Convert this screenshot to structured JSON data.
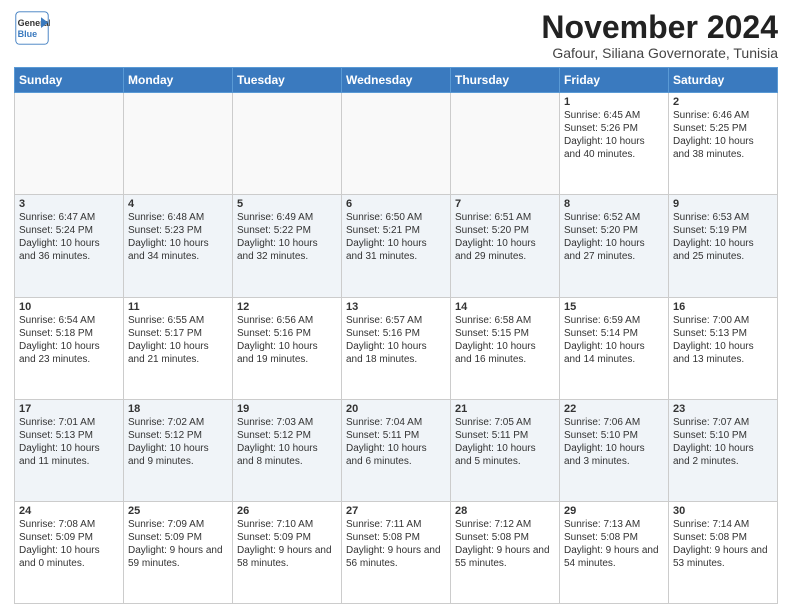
{
  "header": {
    "logo_line1": "General",
    "logo_line2": "Blue",
    "month": "November 2024",
    "location": "Gafour, Siliana Governorate, Tunisia"
  },
  "weekdays": [
    "Sunday",
    "Monday",
    "Tuesday",
    "Wednesday",
    "Thursday",
    "Friday",
    "Saturday"
  ],
  "weeks": [
    [
      {
        "day": "",
        "content": ""
      },
      {
        "day": "",
        "content": ""
      },
      {
        "day": "",
        "content": ""
      },
      {
        "day": "",
        "content": ""
      },
      {
        "day": "",
        "content": ""
      },
      {
        "day": "1",
        "content": "Sunrise: 6:45 AM\nSunset: 5:26 PM\nDaylight: 10 hours and 40 minutes."
      },
      {
        "day": "2",
        "content": "Sunrise: 6:46 AM\nSunset: 5:25 PM\nDaylight: 10 hours and 38 minutes."
      }
    ],
    [
      {
        "day": "3",
        "content": "Sunrise: 6:47 AM\nSunset: 5:24 PM\nDaylight: 10 hours and 36 minutes."
      },
      {
        "day": "4",
        "content": "Sunrise: 6:48 AM\nSunset: 5:23 PM\nDaylight: 10 hours and 34 minutes."
      },
      {
        "day": "5",
        "content": "Sunrise: 6:49 AM\nSunset: 5:22 PM\nDaylight: 10 hours and 32 minutes."
      },
      {
        "day": "6",
        "content": "Sunrise: 6:50 AM\nSunset: 5:21 PM\nDaylight: 10 hours and 31 minutes."
      },
      {
        "day": "7",
        "content": "Sunrise: 6:51 AM\nSunset: 5:20 PM\nDaylight: 10 hours and 29 minutes."
      },
      {
        "day": "8",
        "content": "Sunrise: 6:52 AM\nSunset: 5:20 PM\nDaylight: 10 hours and 27 minutes."
      },
      {
        "day": "9",
        "content": "Sunrise: 6:53 AM\nSunset: 5:19 PM\nDaylight: 10 hours and 25 minutes."
      }
    ],
    [
      {
        "day": "10",
        "content": "Sunrise: 6:54 AM\nSunset: 5:18 PM\nDaylight: 10 hours and 23 minutes."
      },
      {
        "day": "11",
        "content": "Sunrise: 6:55 AM\nSunset: 5:17 PM\nDaylight: 10 hours and 21 minutes."
      },
      {
        "day": "12",
        "content": "Sunrise: 6:56 AM\nSunset: 5:16 PM\nDaylight: 10 hours and 19 minutes."
      },
      {
        "day": "13",
        "content": "Sunrise: 6:57 AM\nSunset: 5:16 PM\nDaylight: 10 hours and 18 minutes."
      },
      {
        "day": "14",
        "content": "Sunrise: 6:58 AM\nSunset: 5:15 PM\nDaylight: 10 hours and 16 minutes."
      },
      {
        "day": "15",
        "content": "Sunrise: 6:59 AM\nSunset: 5:14 PM\nDaylight: 10 hours and 14 minutes."
      },
      {
        "day": "16",
        "content": "Sunrise: 7:00 AM\nSunset: 5:13 PM\nDaylight: 10 hours and 13 minutes."
      }
    ],
    [
      {
        "day": "17",
        "content": "Sunrise: 7:01 AM\nSunset: 5:13 PM\nDaylight: 10 hours and 11 minutes."
      },
      {
        "day": "18",
        "content": "Sunrise: 7:02 AM\nSunset: 5:12 PM\nDaylight: 10 hours and 9 minutes."
      },
      {
        "day": "19",
        "content": "Sunrise: 7:03 AM\nSunset: 5:12 PM\nDaylight: 10 hours and 8 minutes."
      },
      {
        "day": "20",
        "content": "Sunrise: 7:04 AM\nSunset: 5:11 PM\nDaylight: 10 hours and 6 minutes."
      },
      {
        "day": "21",
        "content": "Sunrise: 7:05 AM\nSunset: 5:11 PM\nDaylight: 10 hours and 5 minutes."
      },
      {
        "day": "22",
        "content": "Sunrise: 7:06 AM\nSunset: 5:10 PM\nDaylight: 10 hours and 3 minutes."
      },
      {
        "day": "23",
        "content": "Sunrise: 7:07 AM\nSunset: 5:10 PM\nDaylight: 10 hours and 2 minutes."
      }
    ],
    [
      {
        "day": "24",
        "content": "Sunrise: 7:08 AM\nSunset: 5:09 PM\nDaylight: 10 hours and 0 minutes."
      },
      {
        "day": "25",
        "content": "Sunrise: 7:09 AM\nSunset: 5:09 PM\nDaylight: 9 hours and 59 minutes."
      },
      {
        "day": "26",
        "content": "Sunrise: 7:10 AM\nSunset: 5:09 PM\nDaylight: 9 hours and 58 minutes."
      },
      {
        "day": "27",
        "content": "Sunrise: 7:11 AM\nSunset: 5:08 PM\nDaylight: 9 hours and 56 minutes."
      },
      {
        "day": "28",
        "content": "Sunrise: 7:12 AM\nSunset: 5:08 PM\nDaylight: 9 hours and 55 minutes."
      },
      {
        "day": "29",
        "content": "Sunrise: 7:13 AM\nSunset: 5:08 PM\nDaylight: 9 hours and 54 minutes."
      },
      {
        "day": "30",
        "content": "Sunrise: 7:14 AM\nSunset: 5:08 PM\nDaylight: 9 hours and 53 minutes."
      }
    ]
  ]
}
